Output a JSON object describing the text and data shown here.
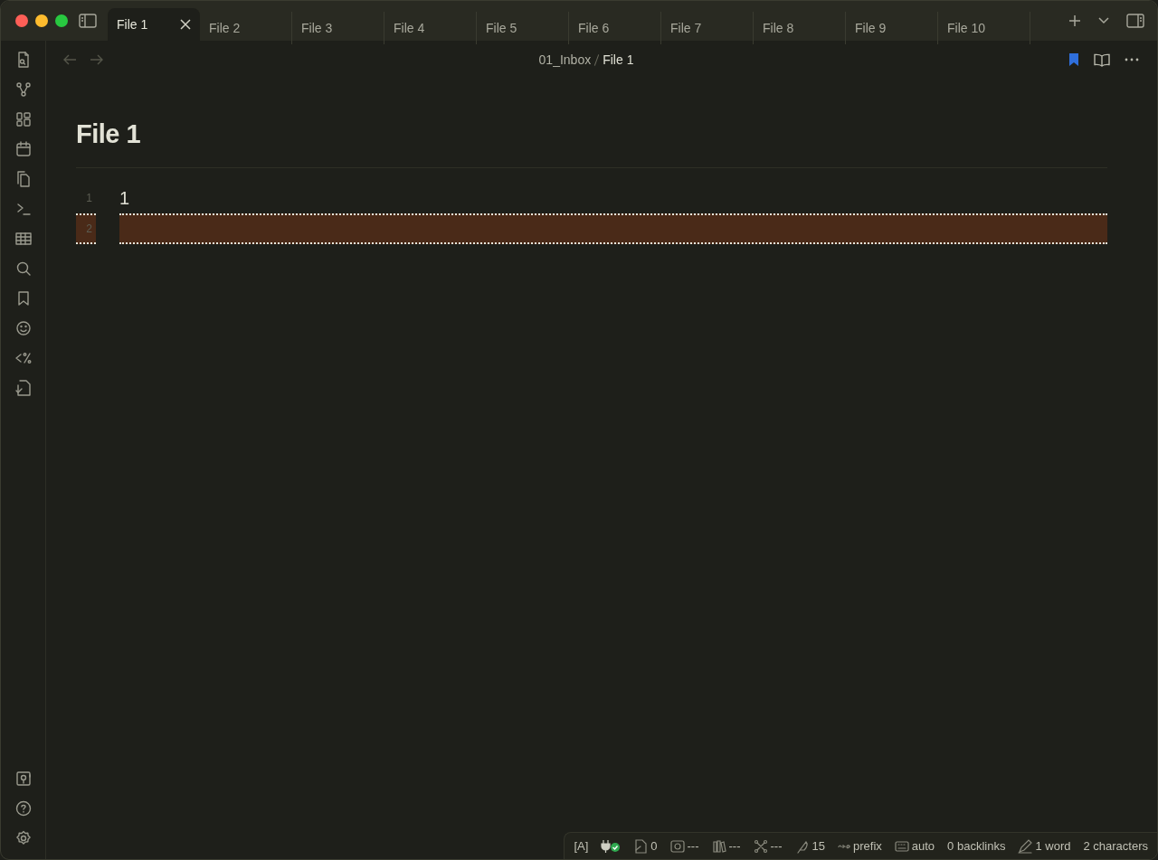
{
  "tabs": [
    {
      "label": "File 1",
      "selected": true
    },
    {
      "label": "File 2",
      "selected": false
    },
    {
      "label": "File 3",
      "selected": false
    },
    {
      "label": "File 4",
      "selected": false
    },
    {
      "label": "File 5",
      "selected": false
    },
    {
      "label": "File 6",
      "selected": false
    },
    {
      "label": "File 7",
      "selected": false
    },
    {
      "label": "File 8",
      "selected": false
    },
    {
      "label": "File 9",
      "selected": false
    },
    {
      "label": "File 10",
      "selected": false
    }
  ],
  "breadcrumb": [
    "01_Inbox",
    "File 1"
  ],
  "note": {
    "title": "File 1",
    "lines": [
      {
        "number": "1",
        "text": "1",
        "highlighted": false
      },
      {
        "number": "2",
        "highlighted": true
      }
    ]
  },
  "status_bar": [
    {
      "kind": "text",
      "text": "[A]"
    },
    {
      "kind": "plugin"
    },
    {
      "kind": "count",
      "text": "0"
    },
    {
      "kind": "count",
      "text": "---"
    },
    {
      "kind": "count",
      "text": "---"
    },
    {
      "kind": "count",
      "text": "---"
    },
    {
      "kind": "count",
      "text": "15"
    },
    {
      "kind": "count",
      "text": "prefix"
    },
    {
      "kind": "count",
      "text": "auto"
    },
    {
      "kind": "text",
      "text": "0 backlinks"
    },
    {
      "kind": "count",
      "text": "1 word"
    },
    {
      "kind": "text",
      "text": "2 characters"
    }
  ]
}
